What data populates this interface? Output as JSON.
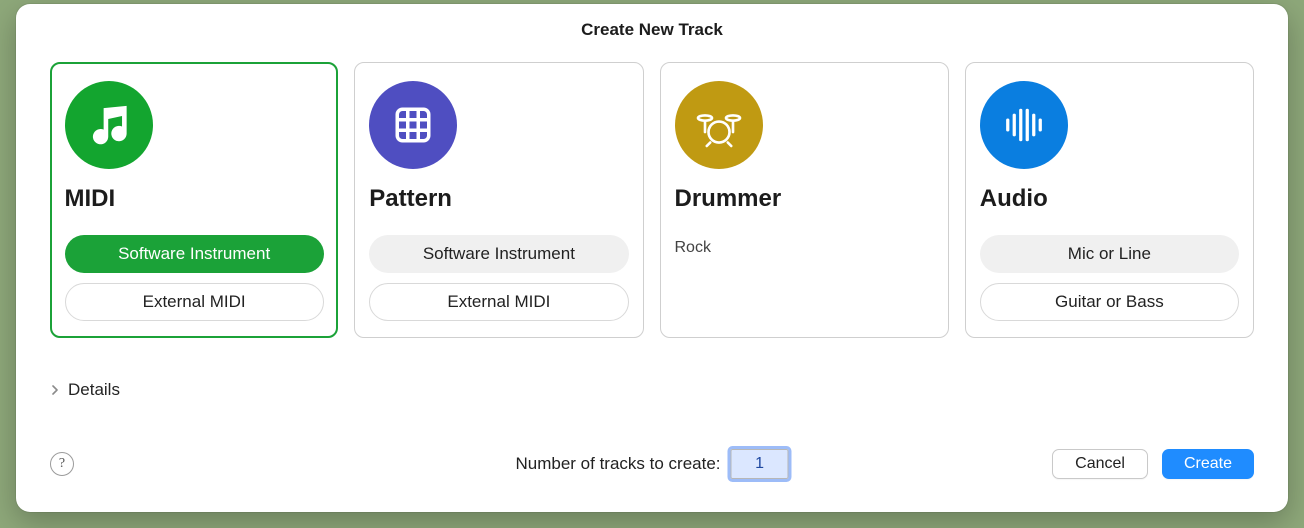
{
  "title": "Create New Track",
  "cards": {
    "midi": {
      "title": "MIDI",
      "opt1": "Software Instrument",
      "opt2": "External MIDI",
      "color": "#13a52f"
    },
    "pattern": {
      "title": "Pattern",
      "opt1": "Software Instrument",
      "opt2": "External MIDI",
      "color": "#4f4ec1"
    },
    "drummer": {
      "title": "Drummer",
      "subtitle": "Rock",
      "color": "#c09a12"
    },
    "audio": {
      "title": "Audio",
      "opt1": "Mic or Line",
      "opt2": "Guitar or Bass",
      "color": "#0a7ee0"
    }
  },
  "details_label": "Details",
  "tracks_label": "Number of tracks to create:",
  "tracks_value": "1",
  "buttons": {
    "cancel": "Cancel",
    "create": "Create",
    "help": "?"
  }
}
